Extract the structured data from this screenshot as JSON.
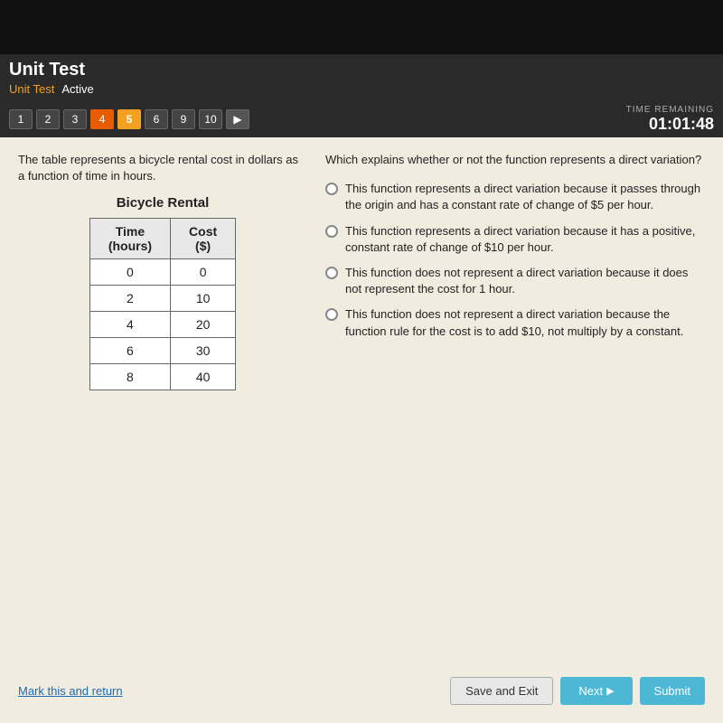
{
  "header": {
    "title": "Unit Test",
    "breadcrumb_link": "Unit Test",
    "breadcrumb_status": "Active"
  },
  "navigation": {
    "buttons": [
      {
        "label": "1",
        "state": "normal"
      },
      {
        "label": "2",
        "state": "normal"
      },
      {
        "label": "3",
        "state": "normal"
      },
      {
        "label": "4",
        "state": "orange"
      },
      {
        "label": "5",
        "state": "active"
      },
      {
        "label": "6",
        "state": "normal"
      },
      {
        "label": "9",
        "state": "normal"
      },
      {
        "label": "10",
        "state": "normal"
      }
    ],
    "play_button": "▶",
    "time_label": "TIME REMAINING",
    "time_value": "01:01:48"
  },
  "question": {
    "left_description": "The table represents a bicycle rental cost in dollars as a function of time in hours.",
    "table_title": "Bicycle Rental",
    "table_headers": [
      "Time\n(hours)",
      "Cost\n($)"
    ],
    "table_rows": [
      [
        "0",
        "0"
      ],
      [
        "2",
        "10"
      ],
      [
        "4",
        "20"
      ],
      [
        "6",
        "30"
      ],
      [
        "8",
        "40"
      ]
    ],
    "right_question": "Which explains whether or not the function represents a direct variation?",
    "options": [
      "This function represents a direct variation because it passes through the origin and has a constant rate of change of $5 per hour.",
      "This function represents a direct variation because it has a positive, constant rate of change of $10 per hour.",
      "This function does not represent a direct variation because it does not represent the cost for 1 hour.",
      "This function does not represent a direct variation because the function rule for the cost is to add $10, not multiply by a constant."
    ]
  },
  "footer": {
    "mark_link": "Mark this and return",
    "save_exit_label": "Save and Exit",
    "next_label": "Next",
    "submit_label": "Submit"
  }
}
